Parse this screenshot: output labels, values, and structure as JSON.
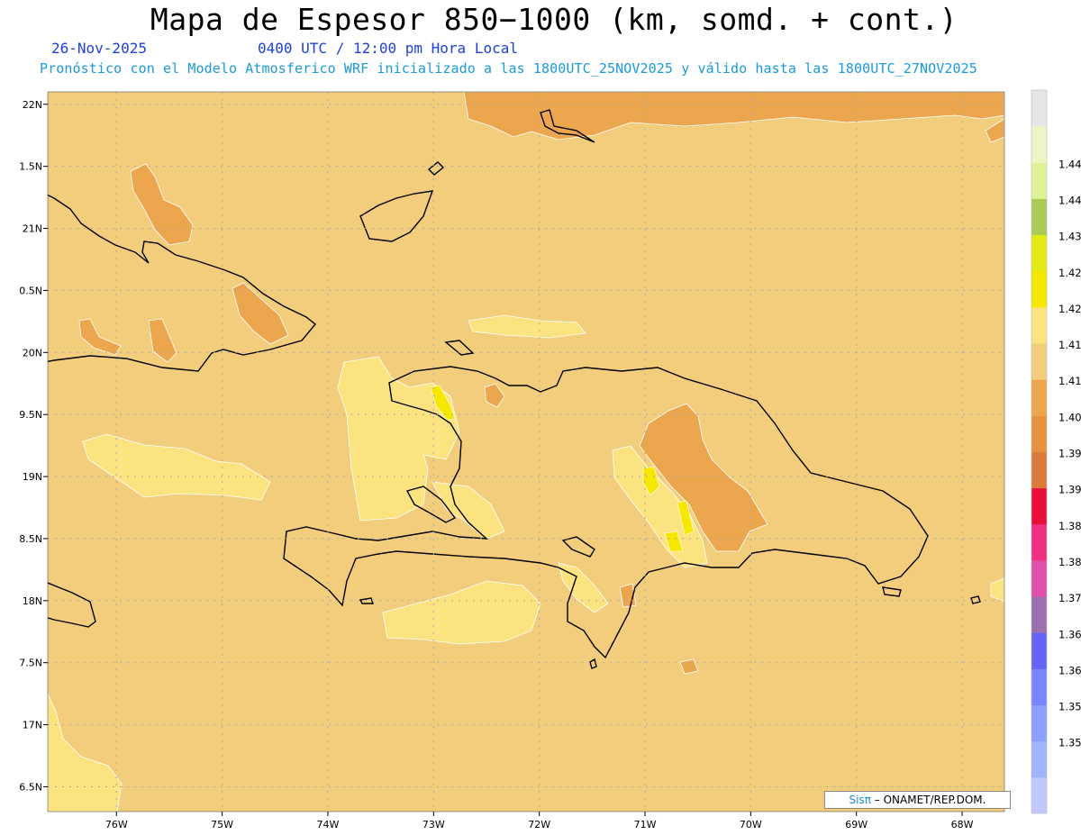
{
  "header": {
    "title": "Mapa de Espesor 850−1000 (km, somd. + cont.)",
    "date": "26-Nov-2025",
    "time": "0400 UTC / 12:00 pm Hora Local",
    "description": "Pronóstico con el Modelo Atmosferico WRF inicializado a las 1800UTC_25NOV2025 y válido hasta las  1800UTC_27NOV2025"
  },
  "map": {
    "lon_range": [
      -76.65,
      -67.6
    ],
    "lat_range": [
      16.3,
      22.1
    ],
    "background_color": "#f2cd7c",
    "coastline_color": "#000000",
    "grid_style": "dotted",
    "x_ticks": [
      {
        "value": -76,
        "label": "76W"
      },
      {
        "value": -75,
        "label": "75W"
      },
      {
        "value": -74,
        "label": "74W"
      },
      {
        "value": -73,
        "label": "73W"
      },
      {
        "value": -72,
        "label": "72W"
      },
      {
        "value": -71,
        "label": "71W"
      },
      {
        "value": -70,
        "label": "70W"
      },
      {
        "value": -69,
        "label": "69W"
      },
      {
        "value": -68,
        "label": "68W"
      }
    ],
    "y_ticks": [
      {
        "value": 22,
        "label": "22N"
      },
      {
        "value": 21.5,
        "label": "1.5N"
      },
      {
        "value": 21,
        "label": "21N"
      },
      {
        "value": 20.5,
        "label": "0.5N"
      },
      {
        "value": 20,
        "label": "20N"
      },
      {
        "value": 19.5,
        "label": "9.5N"
      },
      {
        "value": 19,
        "label": "19N"
      },
      {
        "value": 18.5,
        "label": "8.5N"
      },
      {
        "value": 18,
        "label": "18N"
      },
      {
        "value": 17.5,
        "label": "7.5N"
      },
      {
        "value": 17,
        "label": "17N"
      },
      {
        "value": 16.5,
        "label": "6.5N"
      }
    ]
  },
  "colorbar": {
    "labels": [
      "1.35",
      "1.356",
      "1.362",
      "1.368",
      "1.374",
      "1.38",
      "1.386",
      "1.392",
      "1.398",
      "1.404",
      "1.41",
      "1.416",
      "1.422",
      "1.428",
      "1.434",
      "1.44",
      "1.446"
    ],
    "colors": [
      "#c0c8ff",
      "#a0b4ff",
      "#8ca0ff",
      "#7a86ff",
      "#6464f5",
      "#9b6fb0",
      "#e050a8",
      "#f03080",
      "#e8103a",
      "#dc7a3c",
      "#e6923e",
      "#eca64e",
      "#f2cd7c",
      "#fbe37f",
      "#f6e800",
      "#e3ea14",
      "#abca56",
      "#e0f296",
      "#eef4c6",
      "#e6e6e6"
    ]
  },
  "credit": {
    "brand": "Sisπ",
    "rest": " – ONAMET/REP.DOM."
  }
}
